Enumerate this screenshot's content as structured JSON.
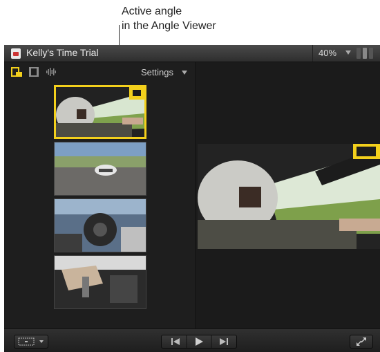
{
  "callout": {
    "line1": "Active angle",
    "line2": "in the Angle Viewer"
  },
  "window": {
    "title": "Kelly's Time Trial",
    "zoom": "40%"
  },
  "toolbar": {
    "settings_label": "Settings"
  },
  "icons": {
    "clip": "clip-icon",
    "filmstrip": "filmstrip-icon",
    "waveform": "waveform-icon",
    "stack": "angle-stack-icon",
    "transform": "transform-icon",
    "prev": "previous-icon",
    "play": "play-icon",
    "next": "next-icon",
    "fullscreen": "fullscreen-icon"
  },
  "colors": {
    "accent": "#f3d01c",
    "background": "#1a1a1a"
  },
  "angles": [
    {
      "name": "angle-1",
      "active": true
    },
    {
      "name": "angle-2",
      "active": false
    },
    {
      "name": "angle-3",
      "active": false
    },
    {
      "name": "angle-4",
      "active": false
    }
  ]
}
